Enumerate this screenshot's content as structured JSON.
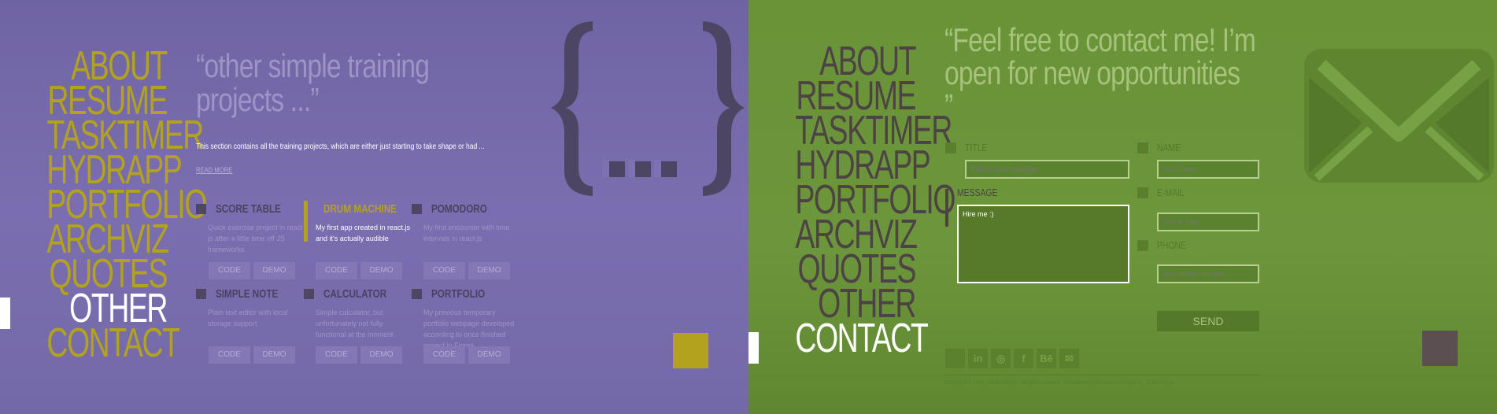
{
  "nav_items": [
    "ABOUT",
    "RESUME",
    "TASKTIMER",
    "HYDRAPP",
    "PORTFOLIO",
    "ARCHVIZ",
    "QUOTES",
    "OTHER",
    "CONTACT"
  ],
  "left": {
    "active_nav": "OTHER",
    "quote": [
      "“other simple training",
      "projects ...”"
    ],
    "description": "This section contains all the training projects, which are either just starting to take shape or had ...",
    "read_more": "READ MORE",
    "projects": [
      {
        "title": "SCORE TABLE",
        "description": "Quick exercise project in react js after a little time off JS frameworks",
        "code": "CODE",
        "demo": "DEMO"
      },
      {
        "title": "DRUM MACHINE",
        "description": "My first app created in react.js and it's actually audible",
        "code": "CODE",
        "demo": "DEMO"
      },
      {
        "title": "POMODORO",
        "description": "My first encounter with time intervals in react.js",
        "code": "CODE",
        "demo": "DEMO"
      },
      {
        "title": "SIMPLE NOTE",
        "description": "Plain text editor with local storage support",
        "code": "CODE",
        "demo": "DEMO"
      },
      {
        "title": "CALCULATOR",
        "description": "Simple calculator, but unfortunately not fully functional at the moment",
        "code": "CODE",
        "demo": "DEMO"
      },
      {
        "title": "PORTFOLIO",
        "description": "My previous temporary portfolio webpage developed according to once finished project in Figma",
        "code": "CODE",
        "demo": "DEMO"
      }
    ],
    "colors": {
      "background": "#7469a8",
      "accent": "#b3a21d"
    }
  },
  "right": {
    "active_nav": "CONTACT",
    "quote": [
      "“Feel free to contact me! I’m",
      "open for new opportunities",
      "”"
    ],
    "form": {
      "title_label": "TITLE",
      "title_placeholder": "Title of your message:",
      "message_label": "MESSAGE",
      "message_value": "Hire me :)",
      "name_label": "NAME",
      "name_placeholder": "Your name:",
      "email_label": "E-MAIL",
      "email_placeholder": "Your e-mail:",
      "phone_label": "PHONE",
      "phone_placeholder": "Your phone number:",
      "send": "SEND"
    },
    "social_icons": [
      "github-icon",
      "linkedin-icon",
      "dribbble-icon",
      "facebook-icon",
      "behance-icon",
      "mail-icon"
    ],
    "social_glyphs": [
      "",
      "in",
      "◎",
      "f",
      "Bē",
      "✉"
    ],
    "footer": "Copyright © 2019, Jakub Stepien. All rights reserved. Website designed and developed by Jakub Stepien.",
    "colors": {
      "background": "#6c963b",
      "text_dark": "#4d4244"
    }
  }
}
